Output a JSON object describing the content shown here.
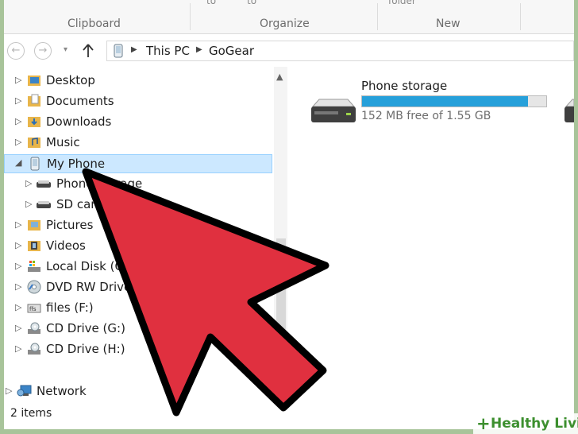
{
  "ribbon": {
    "cut_labels": [
      "to",
      "to",
      "folder"
    ],
    "groups": {
      "clipboard": "Clipboard",
      "organize": "Organize",
      "new": "New"
    }
  },
  "address_bar": {
    "breadcrumbs": [
      "This PC",
      "GoGear"
    ]
  },
  "nav_pane": {
    "items": [
      {
        "label": "Desktop",
        "icon": "desktop-folder-icon"
      },
      {
        "label": "Documents",
        "icon": "documents-folder-icon"
      },
      {
        "label": "Downloads",
        "icon": "downloads-folder-icon"
      },
      {
        "label": "Music",
        "icon": "music-folder-icon"
      },
      {
        "label": "My Phone",
        "icon": "phone-icon",
        "selected": true
      },
      {
        "label": "Phone storage",
        "icon": "storage-drive-icon"
      },
      {
        "label": "SD card",
        "icon": "storage-drive-icon"
      },
      {
        "label": "Pictures",
        "icon": "pictures-folder-icon"
      },
      {
        "label": "Videos",
        "icon": "videos-folder-icon"
      },
      {
        "label": "Local Disk (C:)",
        "icon": "local-disk-icon"
      },
      {
        "label": "DVD RW Drive",
        "icon": "dvd-drive-icon"
      },
      {
        "label": "files (F:)",
        "icon": "network-drive-icon"
      },
      {
        "label": "CD Drive (G:)",
        "icon": "cd-drive-icon"
      },
      {
        "label": "CD Drive (H:)",
        "icon": "cd-drive-icon"
      },
      {
        "label": "Network",
        "icon": "network-icon"
      }
    ]
  },
  "content": {
    "drive": {
      "name": "Phone storage",
      "free_text": "152 MB free of 1.55 GB",
      "used_fraction": 0.9
    }
  },
  "status_bar": {
    "items_text": "2 items"
  },
  "watermark": {
    "plus": "+",
    "text": "Healthy Living"
  },
  "colors": {
    "selection_bg": "#cce8ff",
    "progress_fill": "#26a0da",
    "arrow_red": "#e0303f",
    "watermark_green": "#3c8f2e"
  }
}
